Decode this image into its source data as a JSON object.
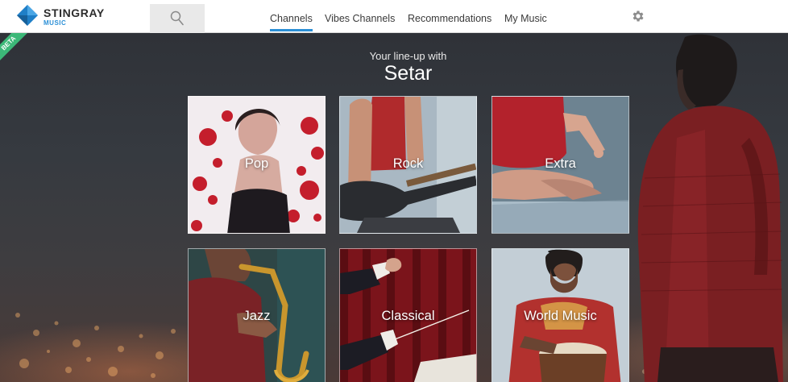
{
  "app": {
    "logo_name": "STINGRAY",
    "logo_sub": "MUSIC",
    "beta_badge": "BETA"
  },
  "nav": {
    "tabs": [
      {
        "label": "Channels",
        "active": true
      },
      {
        "label": "Vibes Channels",
        "active": false
      },
      {
        "label": "Recommendations",
        "active": false
      },
      {
        "label": "My Music",
        "active": false
      }
    ]
  },
  "icons": {
    "search": "search-icon",
    "settings": "gear-icon"
  },
  "hero": {
    "lineup_prefix": "Your line-up with",
    "provider": "Setar"
  },
  "tiles": [
    {
      "label": "Pop"
    },
    {
      "label": "Rock"
    },
    {
      "label": "Extra"
    },
    {
      "label": "Jazz"
    },
    {
      "label": "Classical"
    },
    {
      "label": "World Music"
    }
  ],
  "colors": {
    "accent": "#2b8fd6",
    "beta": "#3cb878",
    "header_bg": "#ffffff"
  }
}
